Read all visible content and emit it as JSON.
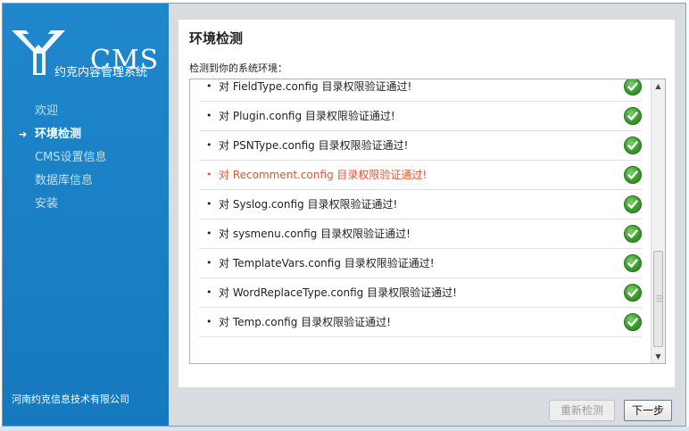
{
  "logo": {
    "text": "CMS",
    "subtitle": "约克内容管理系统"
  },
  "sidebar": {
    "items": [
      {
        "label": "欢迎",
        "active": false
      },
      {
        "label": "环境检测",
        "active": true
      },
      {
        "label": "CMS设置信息",
        "active": false
      },
      {
        "label": "数据库信息",
        "active": false
      },
      {
        "label": "安装",
        "active": false
      }
    ],
    "company": "河南约克信息技术有限公司"
  },
  "main": {
    "title": "环境检测",
    "subtitle": "检测到你的系统环境：",
    "checks": [
      {
        "prefix": "对",
        "text": "FieldType.config 目录权限验证通过!",
        "warn": false,
        "icon": "check-icon"
      },
      {
        "prefix": "对",
        "text": "Plugin.config 目录权限验证通过!",
        "warn": false,
        "icon": "check-icon"
      },
      {
        "prefix": "对",
        "text": "PSNType.config 目录权限验证通过!",
        "warn": false,
        "icon": "check-icon"
      },
      {
        "prefix": "对",
        "text": "Recomment.config 目录权限验证通过!",
        "warn": true,
        "icon": "check-icon"
      },
      {
        "prefix": "对",
        "text": "Syslog.config 目录权限验证通过!",
        "warn": false,
        "icon": "check-icon"
      },
      {
        "prefix": "对",
        "text": "sysmenu.config 目录权限验证通过!",
        "warn": false,
        "icon": "check-icon"
      },
      {
        "prefix": "对",
        "text": "TemplateVars.config 目录权限验证通过!",
        "warn": false,
        "icon": "check-icon"
      },
      {
        "prefix": "对",
        "text": "WordReplaceType.config 目录权限验证通过!",
        "warn": false,
        "icon": "check-icon"
      },
      {
        "prefix": "对",
        "text": "Temp.config 目录权限验证通过!",
        "warn": false,
        "icon": "check-icon"
      }
    ]
  },
  "footer": {
    "recheck_label": "重新检测",
    "next_label": "下一步"
  },
  "colors": {
    "sidebar": "#1a7fc4",
    "warn": "#e8532d",
    "check": "#3a9a2c"
  }
}
